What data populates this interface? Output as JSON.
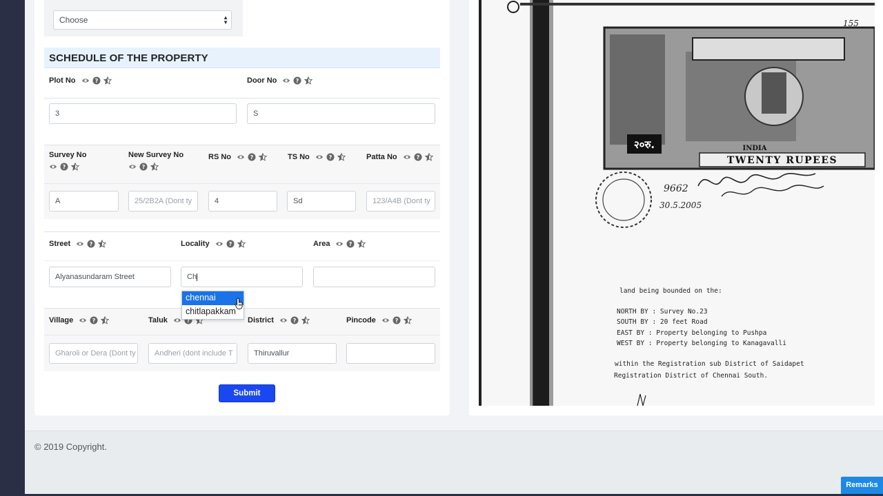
{
  "form": {
    "choose_select": {
      "value": "Choose"
    },
    "section_title": "SCHEDULE OF THE PROPERTY",
    "row1": {
      "plot_no": {
        "label": "Plot No",
        "value": "3"
      },
      "door_no": {
        "label": "Door No",
        "value": "S"
      }
    },
    "row2": {
      "survey_no": {
        "label": "Survey No",
        "value": "A"
      },
      "new_survey_no": {
        "label": "New Survey No",
        "placeholder": "25/2B2A (Dont ty"
      },
      "rs_no": {
        "label": "RS No",
        "value": "4"
      },
      "ts_no": {
        "label": "TS No",
        "value": "Sd"
      },
      "patta_no": {
        "label": "Patta No",
        "placeholder": "123/A4B (Dont ty"
      }
    },
    "row3": {
      "street": {
        "label": "Street",
        "value": "Alyanasundaram Street"
      },
      "locality": {
        "label": "Locality",
        "value": "Ch"
      },
      "area": {
        "label": "Area",
        "value": ""
      }
    },
    "locality_suggestions": [
      "chennai",
      "chitlapakkam"
    ],
    "row4": {
      "village": {
        "label": "Village",
        "placeholder": "Gharoli or Dera (Dont ty"
      },
      "taluk": {
        "label": "Taluk",
        "placeholder": "Andheri (dont include T"
      },
      "district": {
        "label": "District",
        "value": "Thiruvallur"
      },
      "pincode": {
        "label": "Pincode",
        "value": ""
      }
    },
    "submit_label": "Submit"
  },
  "document": {
    "stamp_text": "TWENTY RUPEES",
    "stamp_value": "२०रु.",
    "stamp_country": "INDIA",
    "handwritten_no": "9662",
    "handwritten_date": "30.5.2005",
    "stamp_corner_no": "155",
    "lines": [
      "land being bounded on the:",
      "NORTH BY : Survey No.23",
      "SOUTH BY : 20 feet Road",
      "EAST  BY : Property belonging to Pushpa",
      "WEST  BY : Property belonging to Kanagavalli",
      "within  the  Registration  sub  District  of  Saidapet",
      "Registration District of Chennai South."
    ]
  },
  "footer": {
    "copyright": "© 2019 Copyright."
  },
  "remarks_label": "Remarks",
  "colors": {
    "primary": "#1a48f0",
    "section_bg": "#e8f2fd",
    "sidebar": "#2a2f45",
    "remarks": "#1e88e5"
  },
  "icons": [
    "eye-icon",
    "question-circle-icon",
    "star-half-icon"
  ]
}
